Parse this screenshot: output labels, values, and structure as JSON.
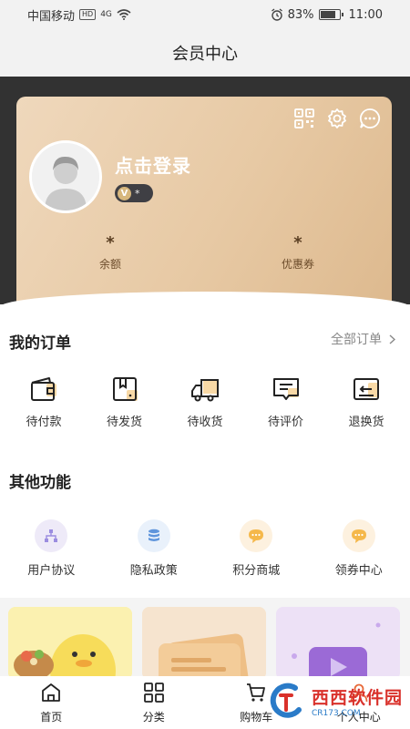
{
  "status_bar": {
    "carrier": "中国移动",
    "hd": "HD",
    "network": "4G",
    "battery": "83%",
    "battery_level": 0.83,
    "time": "11:00"
  },
  "header": {
    "title": "会员中心"
  },
  "member_card": {
    "login_text": "点击登录",
    "vip_level": "*",
    "balance": {
      "value": "*",
      "label": "余额"
    },
    "coupons": {
      "value": "*",
      "label": "优惠券"
    }
  },
  "orders": {
    "title": "我的订单",
    "all_label": "全部订单",
    "items": [
      {
        "label": "待付款",
        "icon": "wallet-icon"
      },
      {
        "label": "待发货",
        "icon": "package-icon"
      },
      {
        "label": "待收货",
        "icon": "truck-icon"
      },
      {
        "label": "待评价",
        "icon": "comment-icon"
      },
      {
        "label": "退换货",
        "icon": "return-icon"
      }
    ]
  },
  "functions": {
    "title": "其他功能",
    "items": [
      {
        "label": "用户协议",
        "icon": "agreement-icon",
        "color": "#eeeaf8"
      },
      {
        "label": "隐私政策",
        "icon": "privacy-icon",
        "color": "#e9f1fb"
      },
      {
        "label": "积分商城",
        "icon": "points-mall-icon",
        "color": "#fdf1df"
      },
      {
        "label": "领券中心",
        "icon": "coupon-center-icon",
        "color": "#fdf1df"
      }
    ]
  },
  "bottom_nav": {
    "items": [
      {
        "label": "首页",
        "icon": "home-icon"
      },
      {
        "label": "分类",
        "icon": "category-icon"
      },
      {
        "label": "购物车",
        "icon": "cart-icon"
      },
      {
        "label": "个人中心",
        "icon": "profile-icon"
      }
    ]
  },
  "watermark": {
    "main": "西西软件园",
    "sub": "CR173.COM"
  },
  "colors": {
    "card_gradient_start": "#efd8bc",
    "card_gradient_end": "#ddb98e",
    "dark_band": "#323232",
    "accent_orange": "#f5a623"
  }
}
